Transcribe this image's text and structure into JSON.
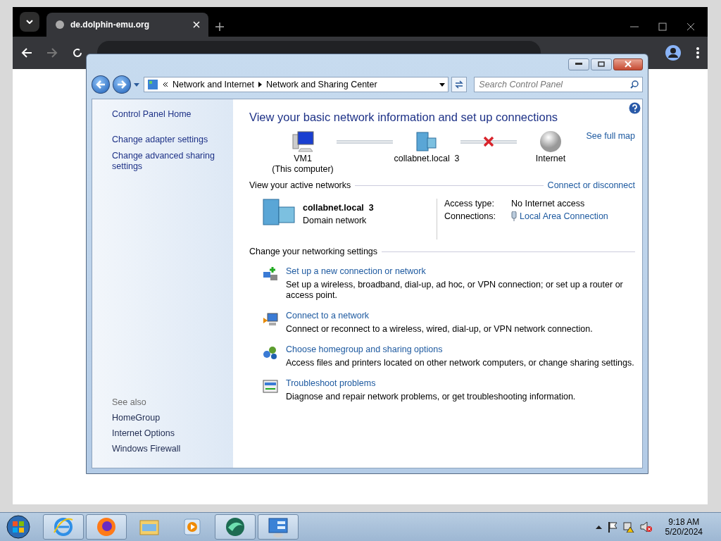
{
  "browser": {
    "tab_title": "de.dolphin-emu.org"
  },
  "explorer": {
    "breadcrumb": [
      "Network and Internet",
      "Network and Sharing Center"
    ],
    "search": {
      "placeholder": "Search Control Panel"
    },
    "sidebar": {
      "home": "Control Panel Home",
      "links": [
        "Change adapter settings",
        "Change advanced sharing settings"
      ],
      "see_also_heading": "See also",
      "see_also": [
        "HomeGroup",
        "Internet Options",
        "Windows Firewall"
      ]
    },
    "main": {
      "title": "View your basic network information and set up connections",
      "see_full_map": "See full map",
      "map": {
        "nodes": [
          {
            "kind": "computer",
            "label": "VM1",
            "sublabel": "(This computer)"
          },
          {
            "kind": "network",
            "label": "collabnet.local  3"
          },
          {
            "kind": "internet",
            "label": "Internet"
          }
        ],
        "links": [
          {
            "broken": false
          },
          {
            "broken": true
          }
        ]
      },
      "active_heading": "View your active networks",
      "connect_link": "Connect or disconnect",
      "network": {
        "name": "collabnet.local  3",
        "category": "Domain network",
        "access_label": "Access type:",
        "access_value": "No Internet access",
        "connections_label": "Connections:",
        "connection": "Local Area Connection"
      },
      "settings_heading": "Change your networking settings",
      "tasks": [
        {
          "kind": "setup",
          "title": "Set up a new connection or network",
          "description": "Set up a wireless, broadband, dial-up, ad hoc, or VPN connection; or set up a router or access point."
        },
        {
          "kind": "connect",
          "title": "Connect to a network",
          "description": "Connect or reconnect to a wireless, wired, dial-up, or VPN network connection."
        },
        {
          "kind": "homegroup",
          "title": "Choose homegroup and sharing options",
          "description": "Access files and printers located on other network computers, or change sharing settings."
        },
        {
          "kind": "troubleshoot",
          "title": "Troubleshoot problems",
          "description": "Diagnose and repair network problems, or get troubleshooting information."
        }
      ]
    }
  },
  "taskbar": {
    "apps": [
      {
        "kind": "ie",
        "running": true
      },
      {
        "kind": "firefox",
        "running": true
      },
      {
        "kind": "folder",
        "running": false
      },
      {
        "kind": "media",
        "running": false
      },
      {
        "kind": "dolphin",
        "running": true
      },
      {
        "kind": "control",
        "running": true
      }
    ],
    "time": "9:18 AM",
    "date": "5/20/2024"
  }
}
